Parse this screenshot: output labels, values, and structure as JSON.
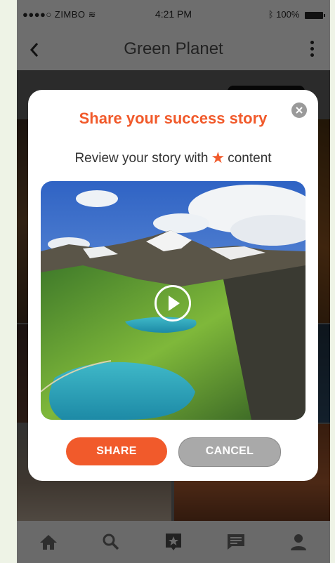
{
  "status_bar": {
    "carrier": "●●●●○ ZIMBO",
    "time": "4:21 PM",
    "battery": "100%"
  },
  "header": {
    "title": "Green Planet",
    "back_icon": "chevron-left-icon",
    "menu_icon": "more-vertical-icon"
  },
  "modal": {
    "title": "Share your success story",
    "subtitle_before": "Review your story with",
    "subtitle_after": "content",
    "star_icon": "star-icon",
    "media_icon": "play-icon",
    "share_label": "SHARE",
    "cancel_label": "CANCEL",
    "close_icon": "close-icon"
  },
  "tab_bar": {
    "items": [
      "home-icon",
      "search-icon",
      "star-badge-icon",
      "chat-icon",
      "profile-icon"
    ]
  },
  "colors": {
    "accent": "#f15a2b",
    "cancel_bg": "#a9a9a9"
  }
}
